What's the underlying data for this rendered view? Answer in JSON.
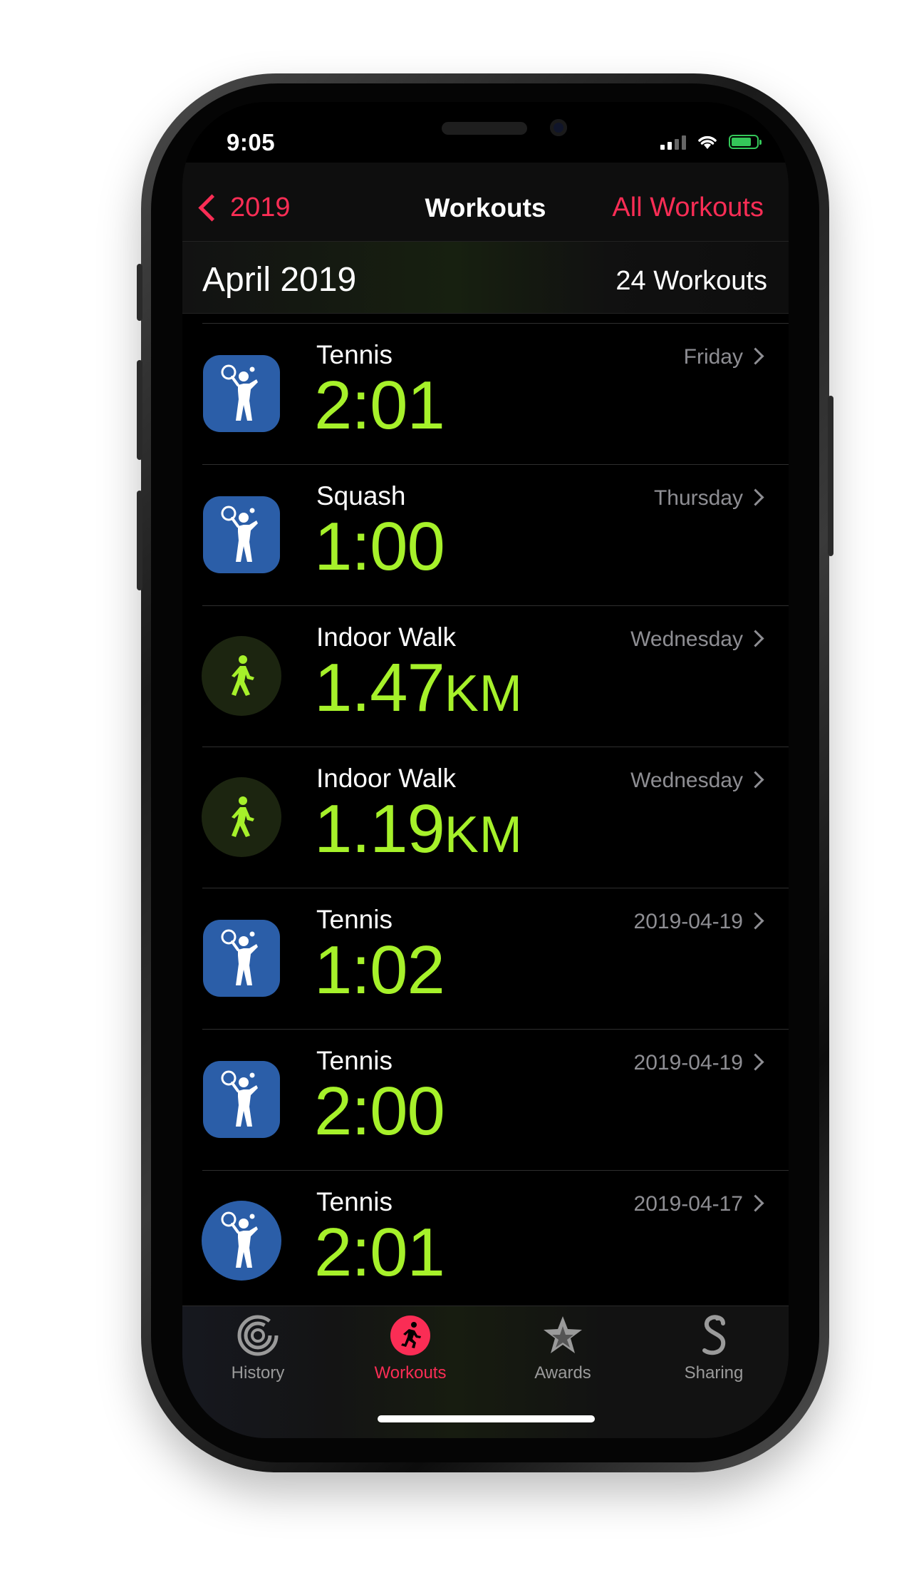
{
  "status": {
    "time": "9:05"
  },
  "nav": {
    "back_label": "2019",
    "title": "Workouts",
    "right_label": "All Workouts"
  },
  "section": {
    "month": "April 2019",
    "count": "24 Workouts"
  },
  "workouts": [
    {
      "name": "Tennis",
      "value": "2:01",
      "unit": "",
      "date": "Friday",
      "icon": "tennis-icon",
      "icon_style": "square-blue"
    },
    {
      "name": "Squash",
      "value": "1:00",
      "unit": "",
      "date": "Thursday",
      "icon": "squash-icon",
      "icon_style": "square-blue"
    },
    {
      "name": "Indoor Walk",
      "value": "1.47",
      "unit": "KM",
      "date": "Wednesday",
      "icon": "walk-icon",
      "icon_style": "circle-green"
    },
    {
      "name": "Indoor Walk",
      "value": "1.19",
      "unit": "KM",
      "date": "Wednesday",
      "icon": "walk-icon",
      "icon_style": "circle-green"
    },
    {
      "name": "Tennis",
      "value": "1:02",
      "unit": "",
      "date": "2019-04-19",
      "icon": "tennis-icon",
      "icon_style": "square-blue"
    },
    {
      "name": "Tennis",
      "value": "2:00",
      "unit": "",
      "date": "2019-04-19",
      "icon": "tennis-icon",
      "icon_style": "square-blue"
    },
    {
      "name": "Tennis",
      "value": "2:01",
      "unit": "",
      "date": "2019-04-17",
      "icon": "tennis-icon",
      "icon_style": "circle-blue"
    }
  ],
  "tabs": [
    {
      "label": "History",
      "icon": "history-rings-icon",
      "active": false
    },
    {
      "label": "Workouts",
      "icon": "runner-icon",
      "active": true
    },
    {
      "label": "Awards",
      "icon": "star-award-icon",
      "active": false
    },
    {
      "label": "Sharing",
      "icon": "sharing-icon",
      "active": false
    }
  ],
  "colors": {
    "accent": "#fa2d55",
    "metric": "#a6f12a",
    "icon_blue": "#2b5ea8",
    "secondary_text": "#8e8e93"
  }
}
